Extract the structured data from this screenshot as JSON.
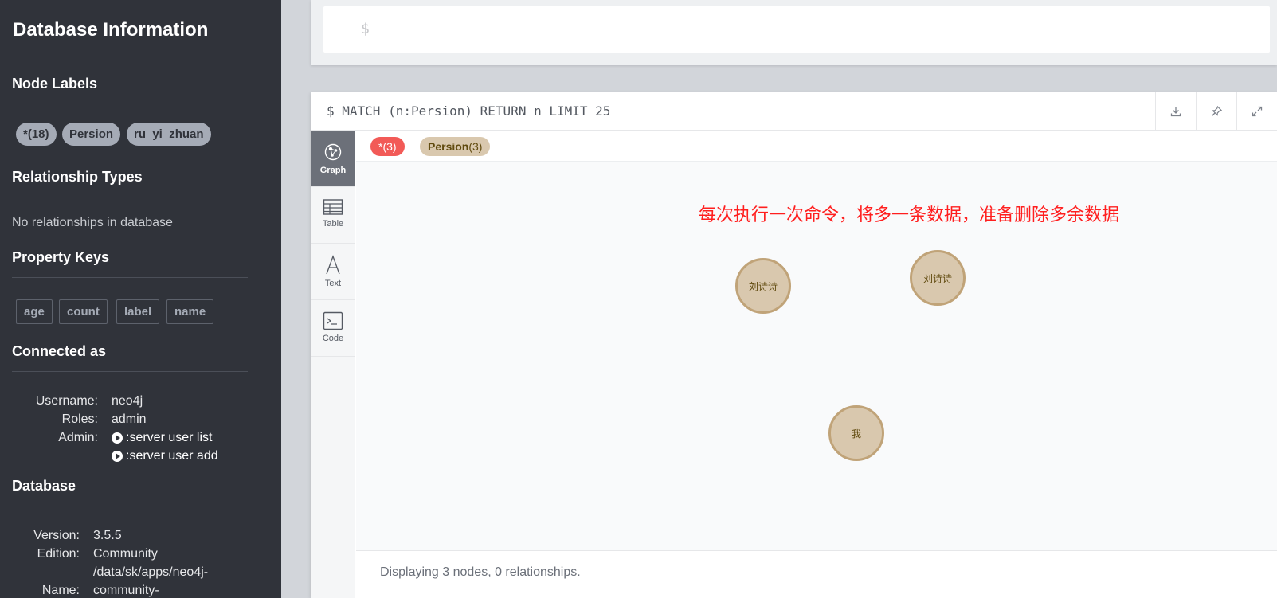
{
  "sidebar": {
    "title": "Database Information",
    "node_labels": {
      "heading": "Node Labels",
      "items": [
        "*(18)",
        "Persion",
        "ru_yi_zhuan"
      ]
    },
    "relationship_types": {
      "heading": "Relationship Types",
      "empty_text": "No relationships in database"
    },
    "property_keys": {
      "heading": "Property Keys",
      "items": [
        "age",
        "count",
        "label",
        "name"
      ]
    },
    "connected_as": {
      "heading": "Connected as",
      "username_label": "Username:",
      "username": "neo4j",
      "roles_label": "Roles:",
      "roles": "admin",
      "admin_label": "Admin:",
      "commands": [
        ":server user list",
        ":server user add"
      ]
    },
    "database": {
      "heading": "Database",
      "version_label": "Version:",
      "version": "3.5.5",
      "edition_label": "Edition:",
      "edition": "Community",
      "name_label": "Name:",
      "name_line1": "/data/sk/apps/neo4j-",
      "name_line2": "community-"
    }
  },
  "editor": {
    "prompt": "$"
  },
  "result": {
    "query": "$ MATCH (n:Persion) RETURN n LIMIT 25",
    "header_icons": [
      "download-icon",
      "pin-icon",
      "expand-icon"
    ],
    "view_tabs": [
      {
        "label": "Graph",
        "icon": "graph-icon",
        "active": true
      },
      {
        "label": "Table",
        "icon": "table-icon",
        "active": false
      },
      {
        "label": "Text",
        "icon": "text-icon",
        "active": false
      },
      {
        "label": "Code",
        "icon": "code-icon",
        "active": false
      }
    ],
    "label_pills": {
      "all": "*(3)",
      "persion_name": "Persion",
      "persion_count": "(3)"
    },
    "annotation": "每次执行一次命令，将多一条数据，准备删除多余数据",
    "nodes": [
      "刘诗诗",
      "刘诗诗",
      "我"
    ],
    "status": "Displaying 3 nodes, 0 relationships."
  },
  "colors": {
    "sidebar_bg": "#30333a",
    "node_fill": "#d9c8ae",
    "node_stroke": "#c0a378",
    "all_pill": "#f25a57",
    "annotation": "#ff1e1e"
  }
}
